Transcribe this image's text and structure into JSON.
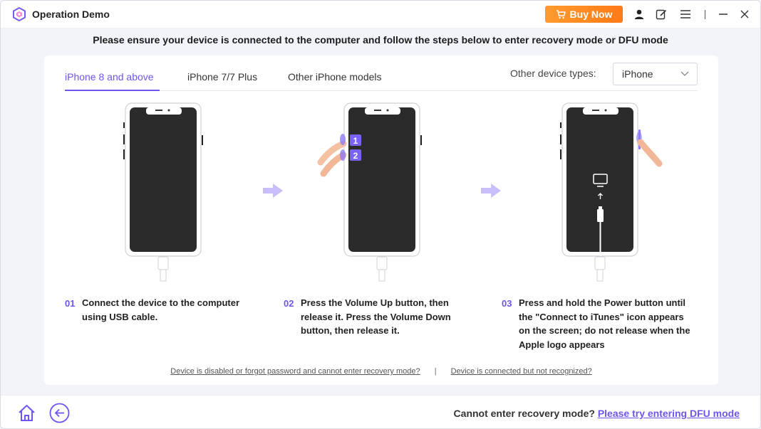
{
  "app": {
    "title": "Operation Demo",
    "buy_label": "Buy Now",
    "icons": [
      "app-logo-icon",
      "cart-icon",
      "user-icon",
      "edit-icon",
      "menu-icon",
      "minimize-icon",
      "close-icon"
    ]
  },
  "instruction": "Please ensure your device is connected to the computer and follow the steps below to enter recovery mode or DFU mode",
  "tabs": [
    {
      "label": "iPhone 8 and above",
      "active": true
    },
    {
      "label": "iPhone 7/7 Plus",
      "active": false
    },
    {
      "label": "Other iPhone models",
      "active": false
    }
  ],
  "device_type": {
    "label": "Other device types:",
    "selected": "iPhone"
  },
  "illustrations": {
    "badge_1": "1",
    "badge_2": "2"
  },
  "steps": [
    {
      "num": "01",
      "lines": [
        "Connect the device to the computer",
        "using USB cable."
      ]
    },
    {
      "num": "02",
      "lines": [
        "Press the Volume Up button, then",
        "release it. Press the Volume Down",
        "button, then release it."
      ]
    },
    {
      "num": "03",
      "lines": [
        "Press and hold the Power button until",
        "the \"Connect to iTunes\" icon appears",
        "on the screen; do not release when the",
        "Apple logo appears"
      ]
    }
  ],
  "help": {
    "link1": "Device is disabled or forgot password and cannot enter recovery mode?",
    "separator": "|",
    "link2": "Device is connected but not recognized?"
  },
  "footer": {
    "prompt": "Cannot enter recovery mode?",
    "dfu_link": "Please try entering DFU mode"
  },
  "colors": {
    "accent": "#6d55f0",
    "buy": "#ff8a1f",
    "phone_screen": "#2b2b2b",
    "arrow": "#c9bdfa"
  }
}
